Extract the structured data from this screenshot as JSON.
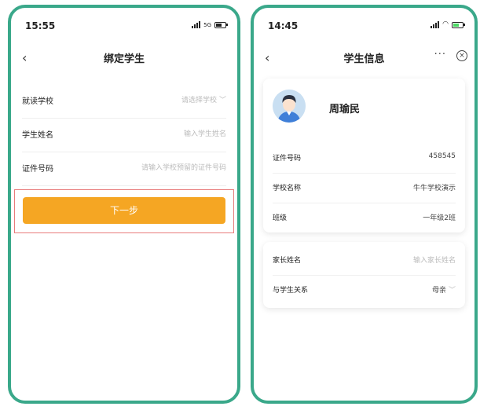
{
  "left": {
    "status": {
      "time": "15:55",
      "network": "5G"
    },
    "nav": {
      "back": "‹",
      "title": "绑定学生"
    },
    "fields": [
      {
        "label": "就读学校",
        "placeholder": "请选择学校",
        "chevron": "﹀"
      },
      {
        "label": "学生姓名",
        "placeholder": "输入学生姓名"
      },
      {
        "label": "证件号码",
        "placeholder": "请输入学校预留的证件号码"
      }
    ],
    "next_button": "下一步"
  },
  "right": {
    "status": {
      "time": "14:45"
    },
    "nav": {
      "back": "‹",
      "title": "学生信息",
      "more": "···",
      "close": "×"
    },
    "student": {
      "name": "周瑜民",
      "rows": [
        {
          "label": "证件号码",
          "value": "458545"
        },
        {
          "label": "学校名称",
          "value": "牛牛学校演示"
        },
        {
          "label": "班级",
          "value": "一年级2班"
        }
      ]
    },
    "parent": {
      "rows": [
        {
          "label": "家长姓名",
          "placeholder": "输入家长姓名"
        },
        {
          "label": "与学生关系",
          "value": "母亲",
          "chevron": "﹀"
        }
      ]
    }
  },
  "colors": {
    "frame": "#3aa88a",
    "button": "#f5a623",
    "highlight": "#e87c7c"
  }
}
